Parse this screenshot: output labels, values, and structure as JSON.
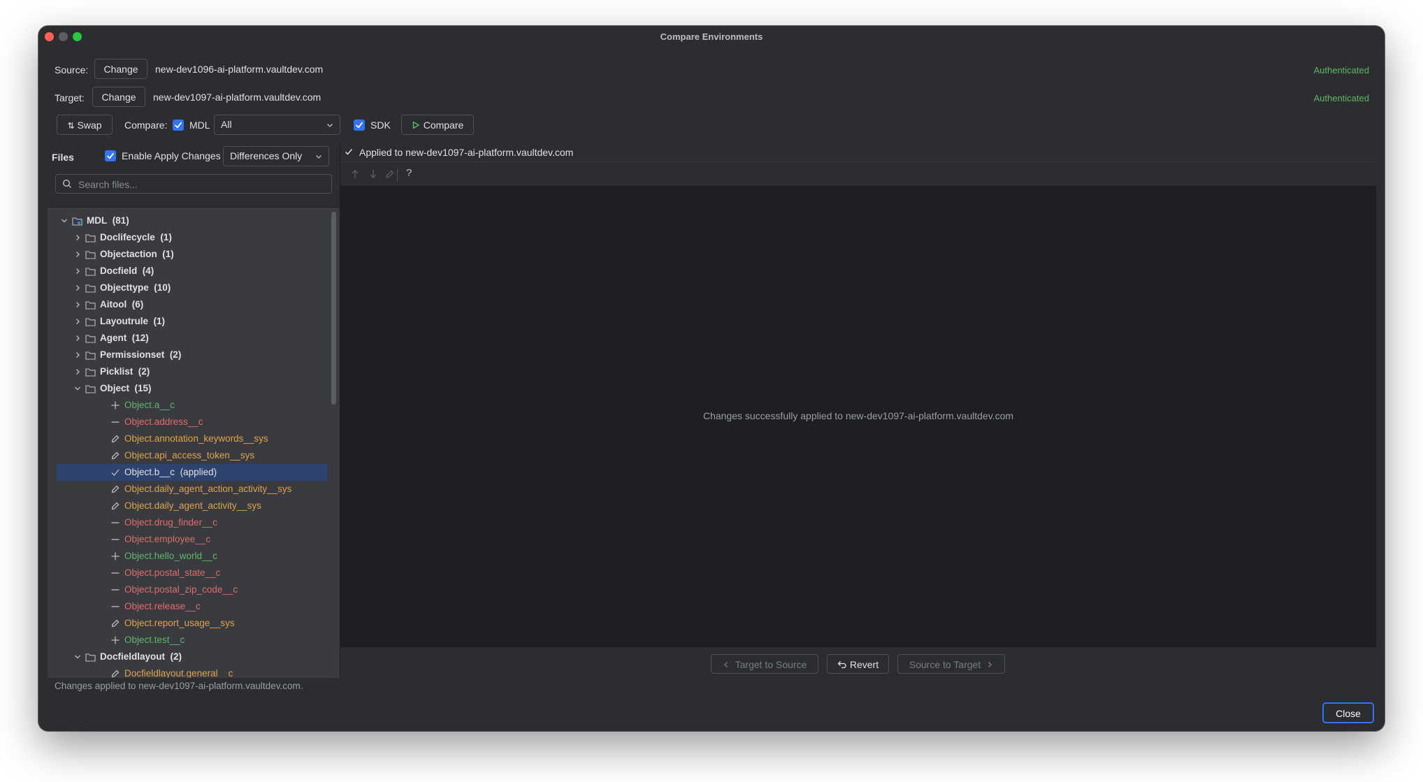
{
  "window": {
    "title": "Compare Environments"
  },
  "source": {
    "label": "Source:",
    "change_label": "Change",
    "host": "new-dev1096-ai-platform.vaultdev.com",
    "auth_status": "Authenticated"
  },
  "target": {
    "label": "Target:",
    "change_label": "Change",
    "host": "new-dev1097-ai-platform.vaultdev.com",
    "auth_status": "Authenticated"
  },
  "toolbar": {
    "swap_label": "Swap",
    "compare_label": "Compare:",
    "mdl": {
      "label": "MDL",
      "checked": true
    },
    "mdl_filter": "All",
    "sdk": {
      "label": "SDK",
      "checked": true
    },
    "compare_button": "Compare"
  },
  "files_panel": {
    "title": "Files",
    "enable_apply": {
      "label": "Enable Apply Changes",
      "checked": true
    },
    "filter": "Differences Only",
    "search_placeholder": "Search files...",
    "tree": [
      {
        "level": 0,
        "expanded": true,
        "folder": true,
        "name": "MDL",
        "count": "(81)"
      },
      {
        "level": 1,
        "expanded": false,
        "folder": true,
        "name": "Doclifecycle",
        "count": "(1)"
      },
      {
        "level": 1,
        "expanded": false,
        "folder": true,
        "name": "Objectaction",
        "count": "(1)"
      },
      {
        "level": 1,
        "expanded": false,
        "folder": true,
        "name": "Docfield",
        "count": "(4)"
      },
      {
        "level": 1,
        "expanded": false,
        "folder": true,
        "name": "Objecttype",
        "count": "(10)"
      },
      {
        "level": 1,
        "expanded": false,
        "folder": true,
        "name": "Aitool",
        "count": "(6)"
      },
      {
        "level": 1,
        "expanded": false,
        "folder": true,
        "name": "Layoutrule",
        "count": "(1)"
      },
      {
        "level": 1,
        "expanded": false,
        "folder": true,
        "name": "Agent",
        "count": "(12)"
      },
      {
        "level": 1,
        "expanded": false,
        "folder": true,
        "name": "Permissionset",
        "count": "(2)"
      },
      {
        "level": 1,
        "expanded": false,
        "folder": true,
        "name": "Picklist",
        "count": "(2)"
      },
      {
        "level": 1,
        "expanded": true,
        "folder": true,
        "name": "Object",
        "count": "(15)"
      },
      {
        "level": 2,
        "status": "added",
        "name": "Object.a__c"
      },
      {
        "level": 2,
        "status": "removed",
        "name": "Object.address__c"
      },
      {
        "level": 2,
        "status": "modified",
        "name": "Object.annotation_keywords__sys"
      },
      {
        "level": 2,
        "status": "modified",
        "name": "Object.api_access_token__sys"
      },
      {
        "level": 2,
        "status": "applied",
        "name": "Object.b__c",
        "suffix": "(applied)",
        "selected": true
      },
      {
        "level": 2,
        "status": "modified",
        "name": "Object.daily_agent_action_activity__sys"
      },
      {
        "level": 2,
        "status": "modified",
        "name": "Object.daily_agent_activity__sys"
      },
      {
        "level": 2,
        "status": "removed",
        "name": "Object.drug_finder__c"
      },
      {
        "level": 2,
        "status": "removed",
        "name": "Object.employee__c"
      },
      {
        "level": 2,
        "status": "added",
        "name": "Object.hello_world__c"
      },
      {
        "level": 2,
        "status": "removed",
        "name": "Object.postal_state__c"
      },
      {
        "level": 2,
        "status": "removed",
        "name": "Object.postal_zip_code__c"
      },
      {
        "level": 2,
        "status": "removed",
        "name": "Object.release__c"
      },
      {
        "level": 2,
        "status": "modified",
        "name": "Object.report_usage__sys"
      },
      {
        "level": 2,
        "status": "added",
        "name": "Object.test__c"
      },
      {
        "level": 1,
        "expanded": true,
        "folder": true,
        "name": "Docfieldlayout",
        "count": "(2)"
      },
      {
        "level": 2,
        "status": "modified",
        "name": "Docfieldlayout.general__c"
      }
    ]
  },
  "diff_panel": {
    "applied_banner": "Applied to new-dev1097-ai-platform.vaultdev.com",
    "help_label": "?",
    "center_message": "Changes successfully applied to new-dev1097-ai-platform.vaultdev.com",
    "target_to_source": "Target to Source",
    "revert": "Revert",
    "source_to_target": "Source to Target"
  },
  "footer": {
    "status": "Changes applied to new-dev1097-ai-platform.vaultdev.com.",
    "close_label": "Close"
  },
  "colors": {
    "added": "#5fb865",
    "removed": "#e06c6c",
    "modified": "#e0a34a",
    "accent": "#3574f0"
  }
}
